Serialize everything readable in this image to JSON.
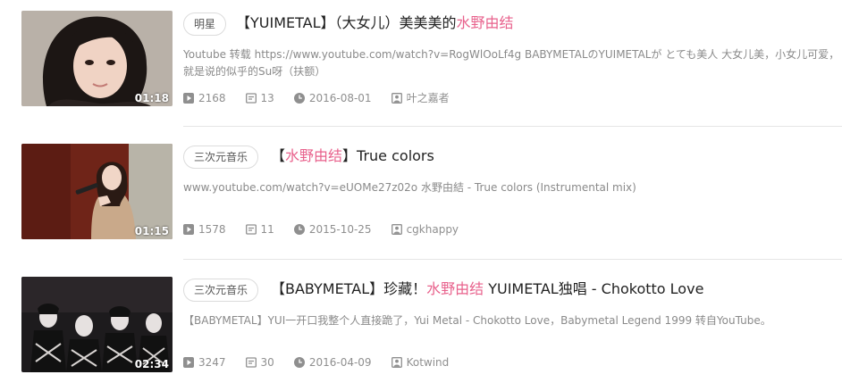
{
  "items": [
    {
      "tag": "明星",
      "title_pre": "【YUIMETAL】（大女儿）美美美的",
      "title_hl": "水野由结",
      "title_post": "",
      "duration": "01:18",
      "description": "Youtube 转载 https://www.youtube.com/watch?v=RogWlOoLf4g BABYMETALのYUIMETALが とても美人 大女儿美，小女儿可爱，就是说的似乎的Su呀（扶额）",
      "plays": "2168",
      "comments": "13",
      "date": "2016-08-01",
      "uploader": "叶之嘉者"
    },
    {
      "tag": "三次元音乐",
      "title_pre": "【",
      "title_hl": "水野由结",
      "title_post": "】True colors",
      "duration": "01:15",
      "description": "www.youtube.com/watch?v=eUOMe27z02o 水野由結 - True colors (Instrumental mix)",
      "plays": "1578",
      "comments": "11",
      "date": "2015-10-25",
      "uploader": "cgkhappy"
    },
    {
      "tag": "三次元音乐",
      "title_pre": "【BABYMETAL】珍藏！",
      "title_hl": "水野由结",
      "title_post": " YUIMETAL独唱 - Chokotto Love",
      "duration": "02:34",
      "description": "【BABYMETAL】YUI一开口我整个人直接跪了，Yui Metal - Chokotto Love，Babymetal Legend 1999 转自YouTube。",
      "plays": "3247",
      "comments": "30",
      "date": "2016-04-09",
      "uploader": "Kotwind"
    }
  ],
  "colors": {
    "highlight": "#e8618c",
    "meta_text": "#8f8f8f",
    "title_text": "#222222"
  },
  "icons": {
    "plays": "play-count-icon",
    "comments": "comment-icon",
    "date": "clock-icon",
    "uploader": "user-icon"
  }
}
